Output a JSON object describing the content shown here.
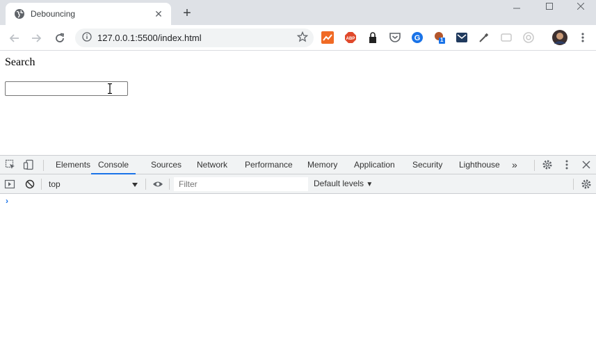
{
  "tab": {
    "title": "Debouncing",
    "favicon": "globe-icon"
  },
  "address": {
    "url": "127.0.0.1:5500/index.html"
  },
  "extensions": [
    "analytics-extension-icon",
    "adblock-plus-icon",
    "lock-extension-icon",
    "pocket-icon",
    "grammarly-icon",
    "notification-extension-icon",
    "mail-extension-icon",
    "eyedropper-icon",
    "ublock-icon",
    "target-icon"
  ],
  "extension_badge": "1",
  "page": {
    "label": "Search",
    "input_value": ""
  },
  "devtools": {
    "tabs": [
      "Elements",
      "Console",
      "Sources",
      "Network",
      "Performance",
      "Memory",
      "Application",
      "Security",
      "Lighthouse"
    ],
    "active_tab": "Console",
    "context": "top",
    "filter_placeholder": "Filter",
    "levels": "Default levels",
    "prompt_symbol": "›"
  },
  "colors": {
    "accent": "#1a73e8",
    "tabstrip": "#dee1e6",
    "devtools_bar": "#f1f3f4"
  }
}
